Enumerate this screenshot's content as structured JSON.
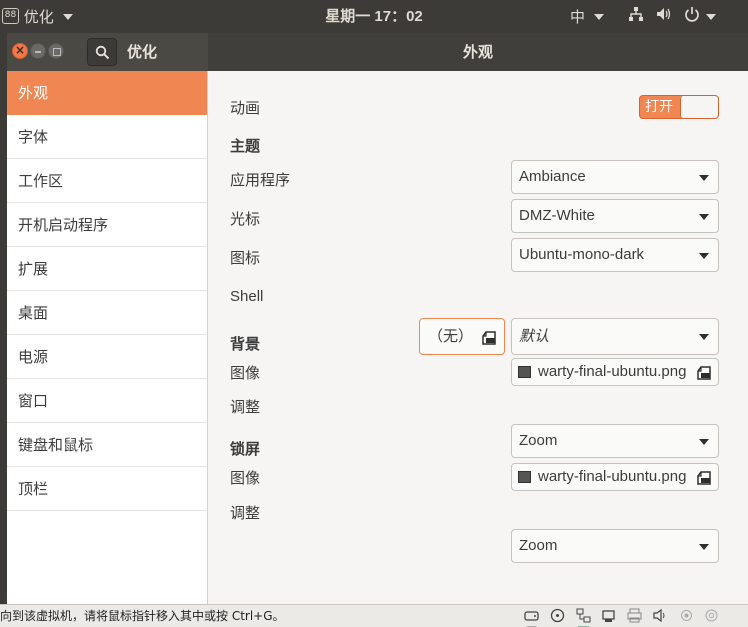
{
  "top_panel": {
    "app_name": "优化",
    "app_icon_glyph": "88",
    "clock": "星期一 17：02",
    "input_method": "中",
    "tray_icons": [
      "network-icon",
      "volume-icon",
      "power-icon"
    ]
  },
  "window": {
    "app_title": "优化",
    "page_title": "外观",
    "close_glyph": "×"
  },
  "sidebar": {
    "items": [
      {
        "label": "外观",
        "active": true
      },
      {
        "label": "字体"
      },
      {
        "label": "工作区"
      },
      {
        "label": "开机启动程序"
      },
      {
        "label": "扩展"
      },
      {
        "label": "桌面"
      },
      {
        "label": "电源"
      },
      {
        "label": "窗口"
      },
      {
        "label": "键盘和鼠标"
      },
      {
        "label": "顶栏"
      }
    ]
  },
  "appearance": {
    "animation_label": "动画",
    "animation_toggle": "打开",
    "themes_title": "主题",
    "applications_label": "应用程序",
    "applications_value": "Ambiance",
    "cursor_label": "光标",
    "cursor_value": "DMZ-White",
    "icons_label": "图标",
    "icons_value": "Ubuntu-mono-dark",
    "shell_label": "Shell",
    "shell_file": "（无）",
    "shell_value": "默认",
    "background_title": "背景",
    "bg_image_label": "图像",
    "bg_image_file": "warty-final-ubuntu.png",
    "bg_adjust_label": "调整",
    "bg_adjust_value": "Zoom",
    "lock_title": "锁屏",
    "lock_image_label": "图像",
    "lock_image_file": "warty-final-ubuntu.png",
    "lock_adjust_label": "调整",
    "lock_adjust_value": "Zoom"
  },
  "status_bar": {
    "text": "向到该虚拟机，请将鼠标指针移入其中或按 Ctrl+G。"
  }
}
